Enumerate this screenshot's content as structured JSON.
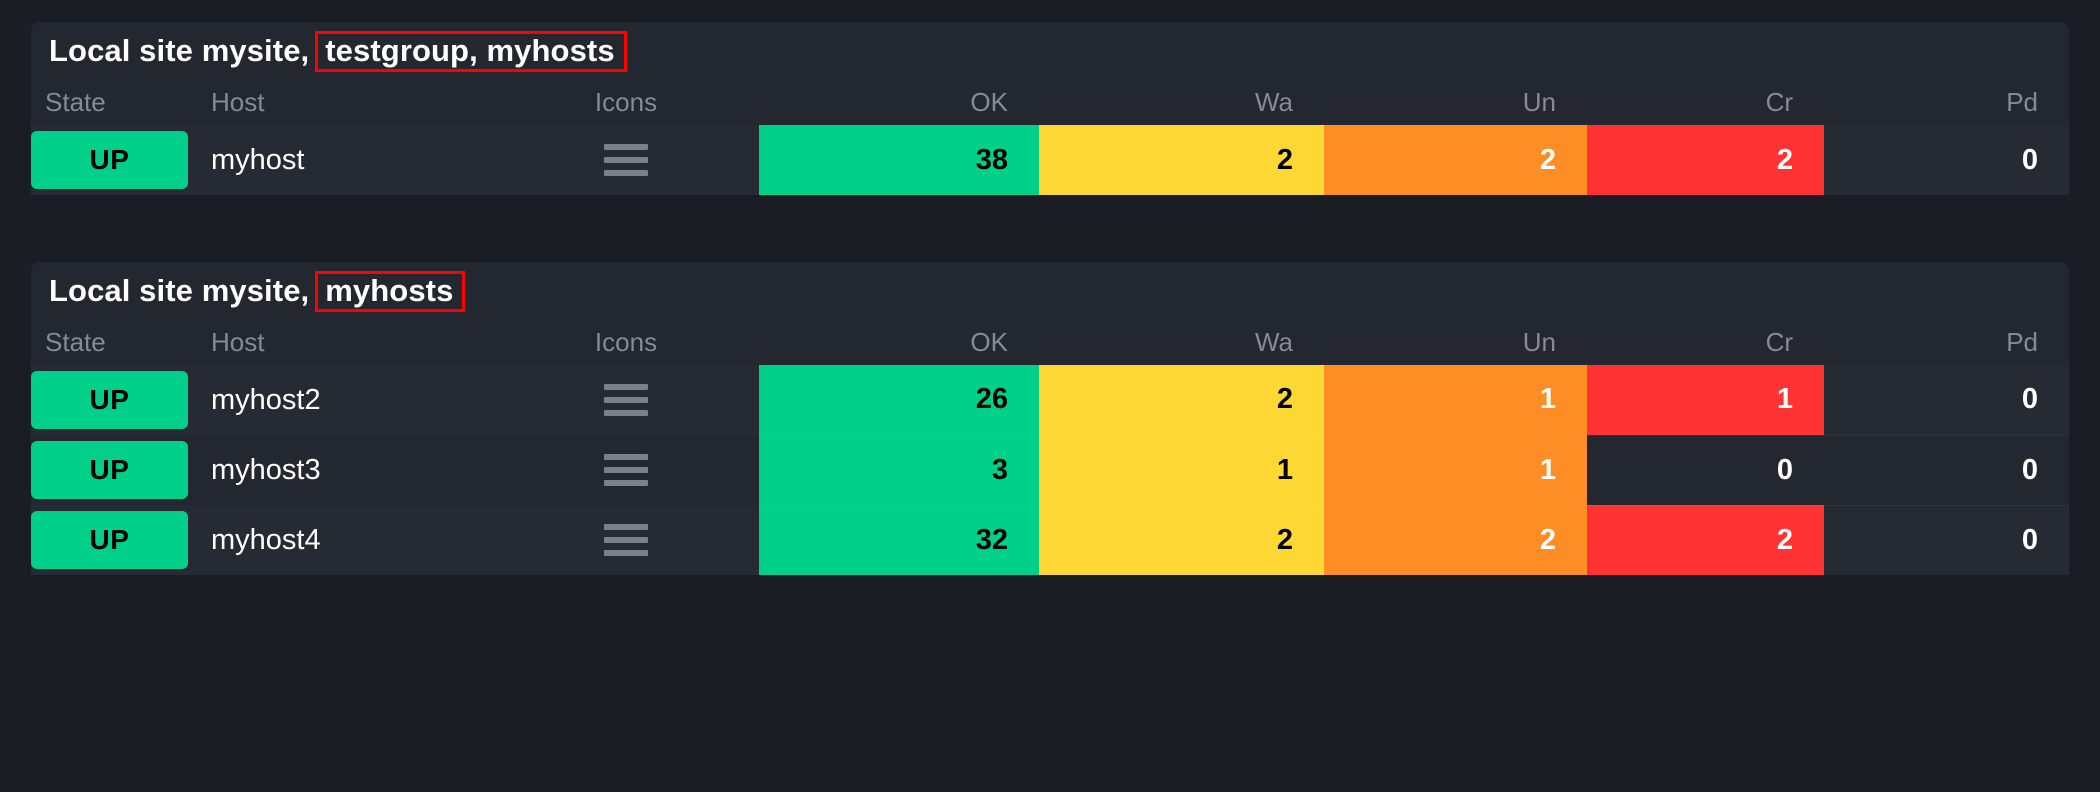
{
  "theme": {
    "page_bg": "#1a1d23",
    "block_bg": "#232730",
    "row_alt_bg": "#262a33",
    "header_text": "#848a96",
    "ok_color": "#00d08a",
    "warn_color": "#fdd835",
    "unknown_color": "#fd8d24",
    "crit_color": "#ff3334",
    "highlight_box": "#ff0000"
  },
  "views": [
    {
      "title_prefix": "Local site mysite,",
      "title_context": "testgroup, myhosts",
      "columns": [
        {
          "key": "state",
          "label": "State",
          "align": "left"
        },
        {
          "key": "host",
          "label": "Host",
          "align": "left"
        },
        {
          "key": "icons",
          "label": "Icons",
          "align": "center"
        },
        {
          "key": "ok",
          "label": "OK",
          "align": "right"
        },
        {
          "key": "wa",
          "label": "Wa",
          "align": "right"
        },
        {
          "key": "un",
          "label": "Un",
          "align": "right"
        },
        {
          "key": "cr",
          "label": "Cr",
          "align": "right"
        },
        {
          "key": "pd",
          "label": "Pd",
          "align": "right"
        }
      ],
      "rows": [
        {
          "state": "UP",
          "host": "myhost",
          "icons": "hamburger-menu-icon",
          "ok": "38",
          "wa": "2",
          "un": "2",
          "cr": "2",
          "pd": "0"
        }
      ]
    },
    {
      "title_prefix": "Local site mysite,",
      "title_context": "myhosts",
      "columns": [
        {
          "key": "state",
          "label": "State",
          "align": "left"
        },
        {
          "key": "host",
          "label": "Host",
          "align": "left"
        },
        {
          "key": "icons",
          "label": "Icons",
          "align": "center"
        },
        {
          "key": "ok",
          "label": "OK",
          "align": "right"
        },
        {
          "key": "wa",
          "label": "Wa",
          "align": "right"
        },
        {
          "key": "un",
          "label": "Un",
          "align": "right"
        },
        {
          "key": "cr",
          "label": "Cr",
          "align": "right"
        },
        {
          "key": "pd",
          "label": "Pd",
          "align": "right"
        }
      ],
      "rows": [
        {
          "state": "UP",
          "host": "myhost2",
          "icons": "hamburger-menu-icon",
          "ok": "26",
          "wa": "2",
          "un": "1",
          "cr": "1",
          "pd": "0"
        },
        {
          "state": "UP",
          "host": "myhost3",
          "icons": "hamburger-menu-icon",
          "ok": "3",
          "wa": "1",
          "un": "1",
          "cr": "0",
          "pd": "0"
        },
        {
          "state": "UP",
          "host": "myhost4",
          "icons": "hamburger-menu-icon",
          "ok": "32",
          "wa": "2",
          "un": "2",
          "cr": "2",
          "pd": "0"
        }
      ]
    }
  ]
}
